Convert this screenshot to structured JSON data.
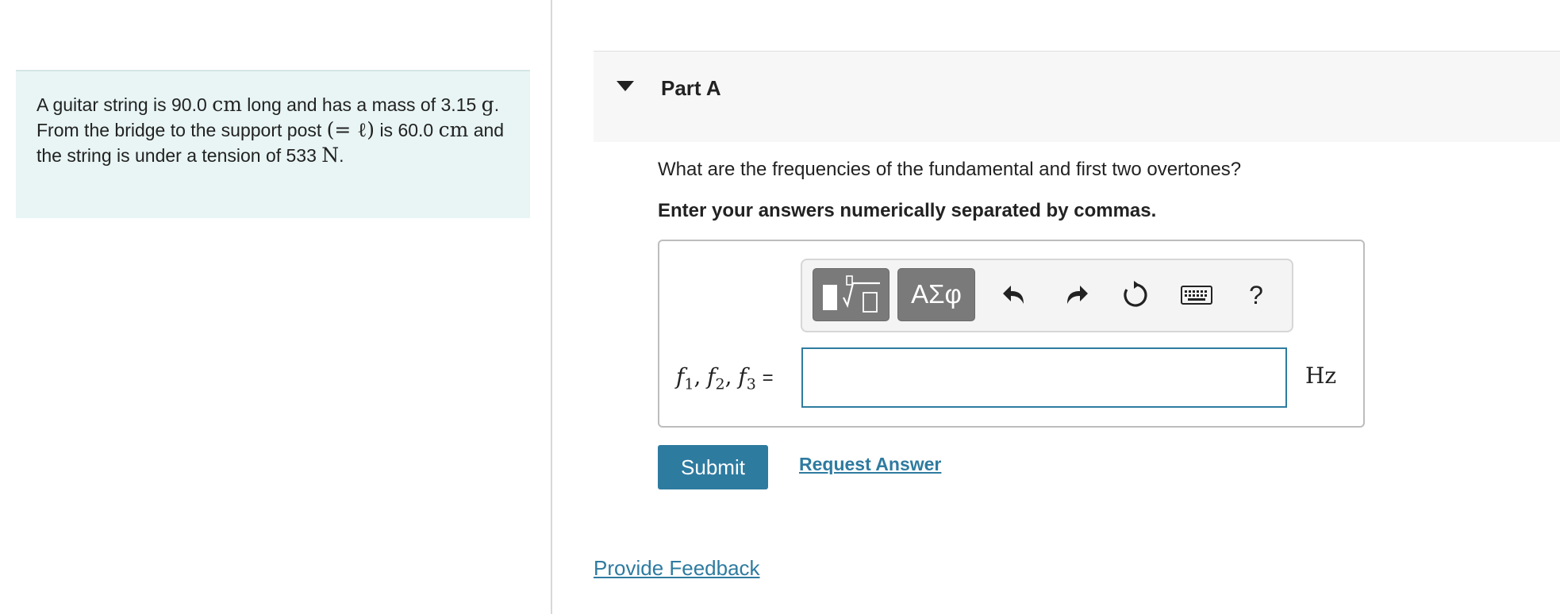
{
  "problem": {
    "t1": "A guitar string is 90.0",
    "u1": "cm",
    "t2": "long and has a mass of",
    "t3": "3.15",
    "u2": "g",
    "t4": ". From the bridge to the support post",
    "m1": "(= ℓ)",
    "t5": "is 60.0",
    "u3": "cm",
    "t6": "and the string is under a tension of 533",
    "u4": "N",
    "t7": "."
  },
  "part": {
    "title": "Part A",
    "question": "What are the frequencies of the fundamental and first two overtones?",
    "instruction": "Enter your answers numerically separated by commas."
  },
  "toolbar": {
    "greek_label": "ΑΣφ",
    "help_label": "?",
    "icons": [
      "templates-icon",
      "undo-icon",
      "redo-icon",
      "reset-icon",
      "keyboard-icon",
      "help-icon"
    ]
  },
  "answer": {
    "f1": "f",
    "s1": "1",
    "f2": "f",
    "s2": "2",
    "f3": "f",
    "s3": "3",
    "sep": ",",
    "equals": "=",
    "value": "",
    "unit": "Hz"
  },
  "actions": {
    "submit": "Submit",
    "request_answer": "Request Answer",
    "provide_feedback": "Provide Feedback"
  },
  "colors": {
    "accent": "#2e7ba0",
    "problem_bg": "#e8f5f4",
    "toolbar_button": "#7a7a7a"
  }
}
